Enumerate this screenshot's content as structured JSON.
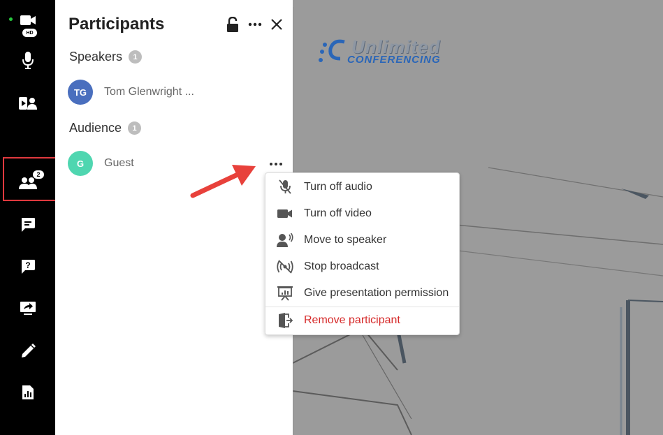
{
  "toolbar": {
    "video_badge": "HD",
    "participants_count": "2"
  },
  "panel": {
    "title": "Participants",
    "speakers_label": "Speakers",
    "speakers_count": "1",
    "audience_label": "Audience",
    "audience_count": "1",
    "speakers": [
      {
        "initials": "TG",
        "name": "Tom Glenwright ...",
        "color": "#4a6fbe"
      }
    ],
    "audience": [
      {
        "initials": "G",
        "name": "Guest",
        "color": "#4fd6b0"
      }
    ]
  },
  "video": {
    "logo_line1": "Unlimited",
    "logo_line2": "CONFERENCING"
  },
  "menu": {
    "items": [
      {
        "label": "Turn off audio",
        "icon": "mic-off-icon"
      },
      {
        "label": "Turn off video",
        "icon": "camera-icon"
      },
      {
        "label": "Move to speaker",
        "icon": "speaker-user-icon"
      },
      {
        "label": "Stop broadcast",
        "icon": "broadcast-off-icon"
      },
      {
        "label": "Give presentation permission",
        "icon": "presentation-icon"
      },
      {
        "label": "Remove participant",
        "icon": "exit-door-icon"
      }
    ]
  },
  "colors": {
    "active_outline": "#e0393e",
    "danger": "#d62a2a",
    "arrow": "#e8413b",
    "toolbar_bg": "#000000",
    "video_bg": "#9b9b9b"
  }
}
